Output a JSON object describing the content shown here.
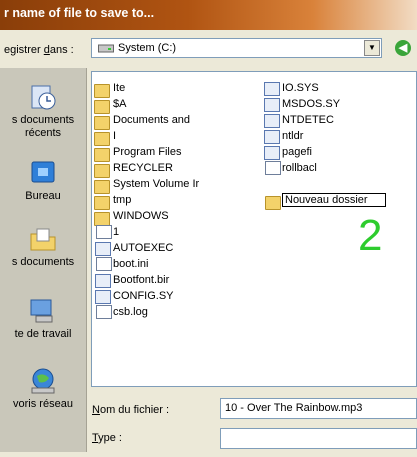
{
  "window": {
    "title": "r name of file to save to..."
  },
  "look_in": {
    "label_prefix": "egistrer ",
    "label_accel": "d",
    "label_suffix": "ans :",
    "value": "System (C:)"
  },
  "places": [
    {
      "label_lines": [
        "s documents",
        "récents"
      ],
      "icon": "recent-documents-icon"
    },
    {
      "label_lines": [
        "Bureau"
      ],
      "icon": "desktop-icon"
    },
    {
      "label_lines": [
        "s documents"
      ],
      "icon": "my-documents-icon"
    },
    {
      "label_lines": [
        "te de travail"
      ],
      "icon": "my-computer-icon"
    },
    {
      "label_lines": [
        "voris réseau"
      ],
      "icon": "network-places-icon"
    }
  ],
  "files_col1": [
    {
      "name": "Ite",
      "kind": "folder"
    },
    {
      "name": "$A",
      "kind": "folder"
    },
    {
      "name": "Documents and",
      "kind": "folder"
    },
    {
      "name": "I",
      "kind": "folder"
    },
    {
      "name": "Program Files",
      "kind": "folder"
    },
    {
      "name": "RECYCLER",
      "kind": "folder"
    },
    {
      "name": "System Volume Ir",
      "kind": "folder"
    },
    {
      "name": "tmp",
      "kind": "folder"
    },
    {
      "name": "WINDOWS",
      "kind": "folder"
    },
    {
      "name": "1",
      "kind": "file"
    },
    {
      "name": "AUTOEXEC",
      "kind": "sys"
    },
    {
      "name": "boot.ini",
      "kind": "file"
    },
    {
      "name": "Bootfont.bir",
      "kind": "sys"
    },
    {
      "name": "CONFIG.SY",
      "kind": "sys"
    },
    {
      "name": "csb.log",
      "kind": "file"
    }
  ],
  "files_col2": [
    {
      "name": "IO.SYS",
      "kind": "sys"
    },
    {
      "name": "MSDOS.SY",
      "kind": "sys"
    },
    {
      "name": "NTDETEC",
      "kind": "sys"
    },
    {
      "name": "ntldr",
      "kind": "sys"
    },
    {
      "name": "pagefi",
      "kind": "sys"
    },
    {
      "name": "rollbacl",
      "kind": "file"
    }
  ],
  "new_folder": {
    "name": "Nouveau dossier"
  },
  "overlay_number": "2",
  "file_name": {
    "label_accel": "N",
    "label_rest": "om du fichier :",
    "value": "10 - Over The Rainbow.mp3"
  },
  "file_type": {
    "label_accel": "T",
    "label_rest": "ype :",
    "value": ""
  },
  "colors": {
    "title_bar": "#b05412",
    "overlay_number": "#2ecc2e",
    "folder": "#f3d26a"
  }
}
